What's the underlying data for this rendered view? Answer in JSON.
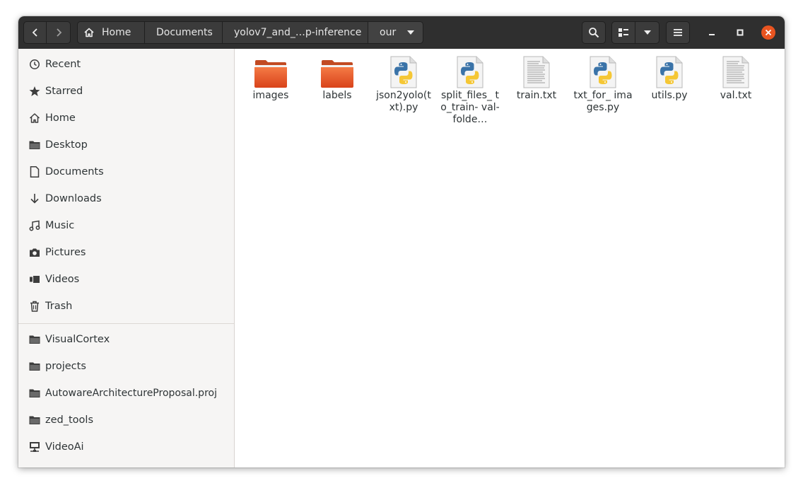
{
  "navigation": {
    "breadcrumbs": [
      "Home",
      "Documents",
      "yolov7_and_…p-inference",
      "our"
    ]
  },
  "sidebar": {
    "places": [
      {
        "label": "Recent",
        "icon": "clock-icon"
      },
      {
        "label": "Starred",
        "icon": "star-icon"
      },
      {
        "label": "Home",
        "icon": "home-icon"
      },
      {
        "label": "Desktop",
        "icon": "folder-icon"
      },
      {
        "label": "Documents",
        "icon": "document-icon"
      },
      {
        "label": "Downloads",
        "icon": "download-icon"
      },
      {
        "label": "Music",
        "icon": "music-icon"
      },
      {
        "label": "Pictures",
        "icon": "camera-icon"
      },
      {
        "label": "Videos",
        "icon": "video-icon"
      },
      {
        "label": "Trash",
        "icon": "trash-icon"
      }
    ],
    "bookmarks": [
      {
        "label": "VisualCortex",
        "icon": "folder-icon"
      },
      {
        "label": "projects",
        "icon": "folder-icon"
      },
      {
        "label": "AutowareArchitectureProposal.proj",
        "icon": "folder-icon"
      },
      {
        "label": "zed_tools",
        "icon": "folder-icon"
      },
      {
        "label": "VideoAi",
        "icon": "network-drive-icon"
      }
    ]
  },
  "files": [
    {
      "name": "images",
      "type": "folder"
    },
    {
      "name": "labels",
      "type": "folder"
    },
    {
      "name": "json2yolo(t xt).py",
      "type": "python"
    },
    {
      "name": "split_files_ to_train- val-folde…",
      "type": "python"
    },
    {
      "name": "train.txt",
      "type": "text"
    },
    {
      "name": "txt_for_ images.py",
      "type": "python"
    },
    {
      "name": "utils.py",
      "type": "python"
    },
    {
      "name": "val.txt",
      "type": "text"
    }
  ],
  "colors": {
    "headerbar": "#2f2f2f",
    "accent": "#e95420",
    "folder": "#e95420",
    "sidebar_bg": "#f6f5f4"
  }
}
